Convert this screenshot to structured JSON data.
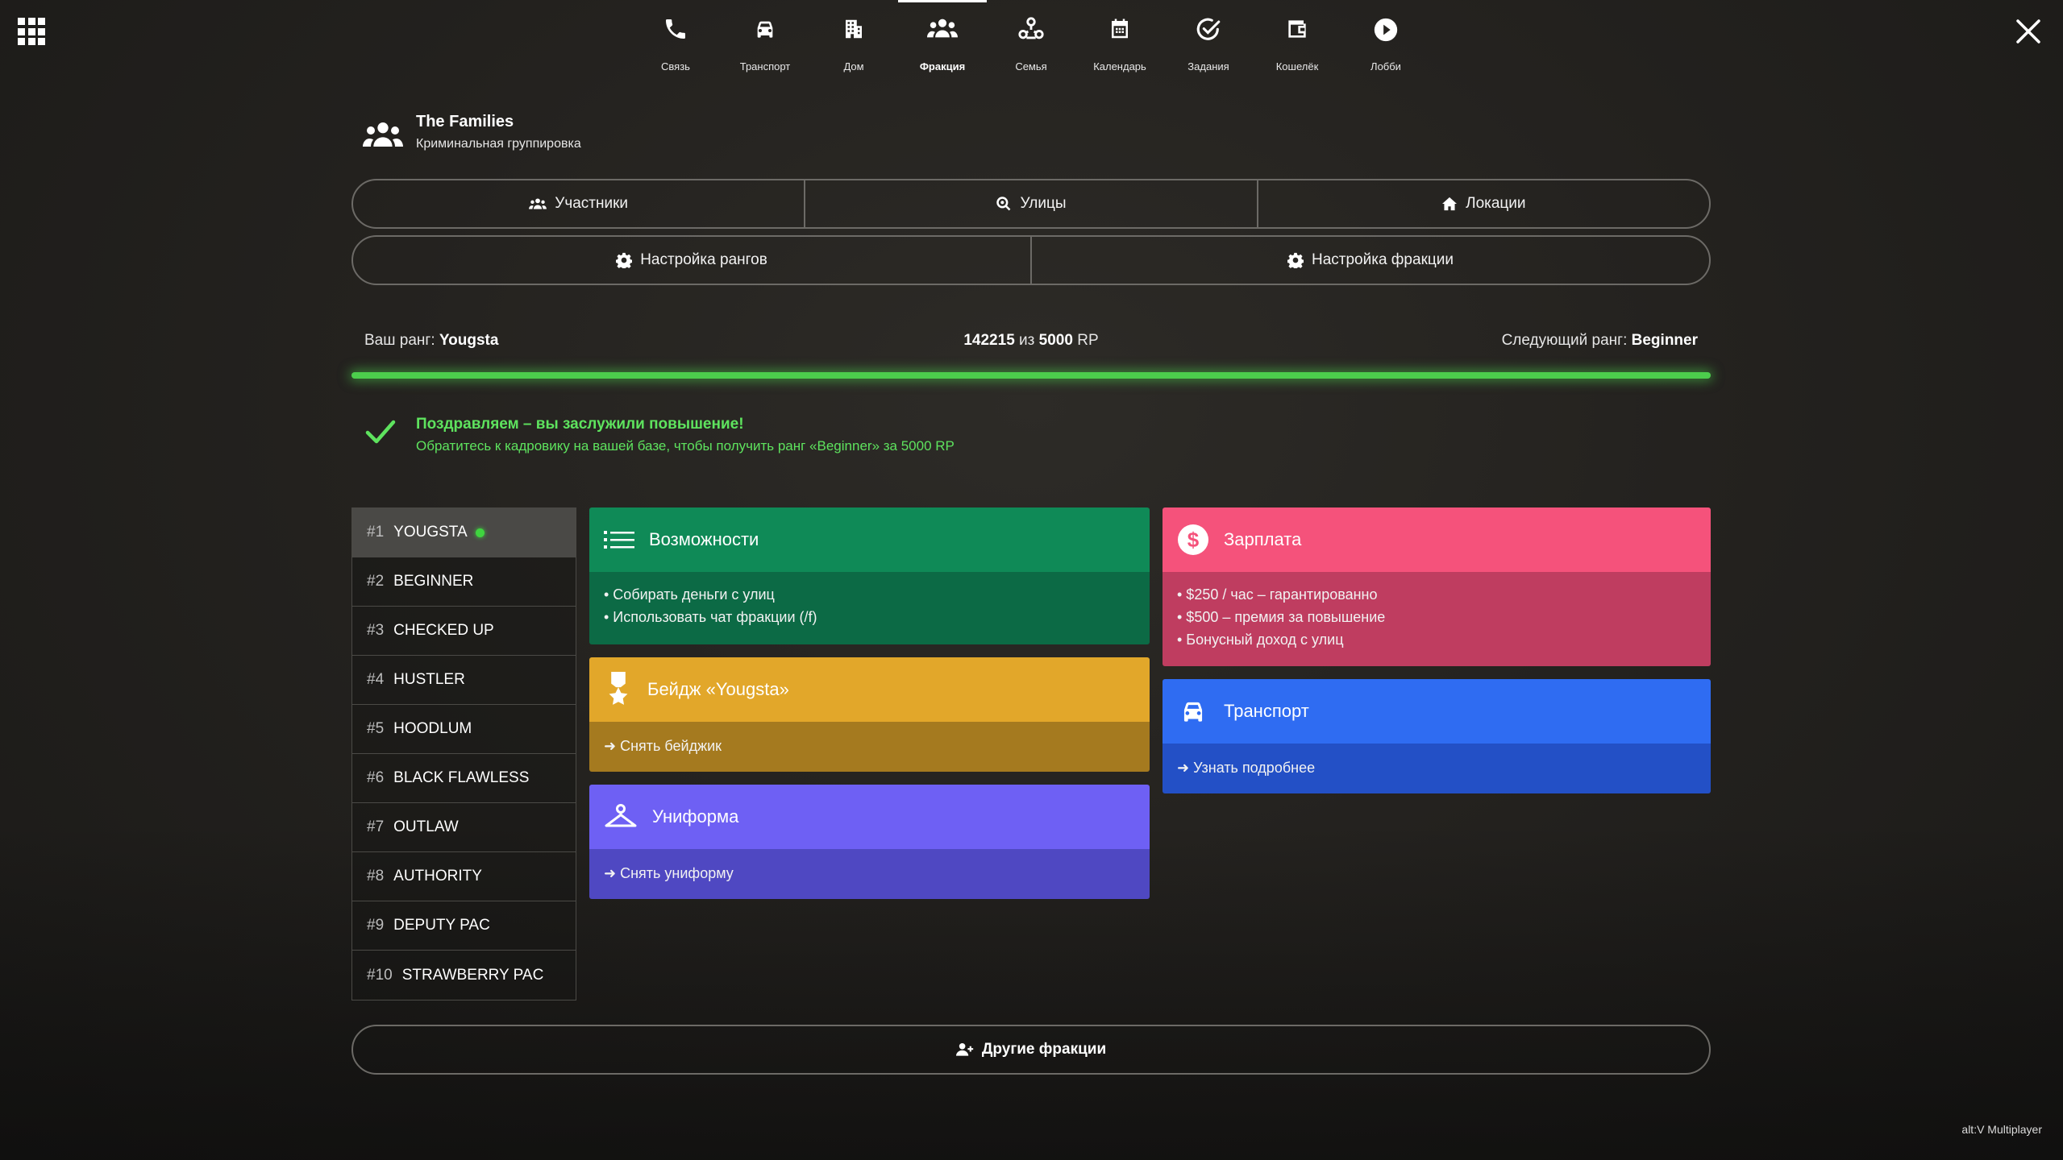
{
  "nav": {
    "items": [
      {
        "label": "Связь",
        "icon": "phone-icon"
      },
      {
        "label": "Транспорт",
        "icon": "car-icon"
      },
      {
        "label": "Дом",
        "icon": "building-icon"
      },
      {
        "label": "Фракция",
        "icon": "users-icon",
        "active": true
      },
      {
        "label": "Семья",
        "icon": "family-icon"
      },
      {
        "label": "Календарь",
        "icon": "calendar-icon"
      },
      {
        "label": "Задания",
        "icon": "check-circle-icon"
      },
      {
        "label": "Кошелёк",
        "icon": "wallet-icon"
      },
      {
        "label": "Лобби",
        "icon": "play-icon"
      }
    ]
  },
  "faction": {
    "name": "The Families",
    "subtitle": "Криминальная группировка"
  },
  "tabs_row1": [
    "Участники",
    "Улицы",
    "Локации"
  ],
  "tabs_row2": [
    "Настройка рангов",
    "Настройка фракции"
  ],
  "rank": {
    "your_label": "Ваш ранг:",
    "your_value": "Yougsta",
    "rp_current": "142215",
    "rp_of": "из",
    "rp_target": "5000",
    "rp_unit": "RP",
    "next_label": "Следующий ранг:",
    "next_value": "Beginner",
    "progress_fraction": 1.0,
    "progress_color": "#4ccd4c"
  },
  "congrats": {
    "title": "Поздравляем – вы заслужили повышение!",
    "text": "Обратитесь к кадровику на вашей базе, чтобы получить ранг «Beginner» за 5000 RP"
  },
  "ranks": [
    {
      "num": "#1",
      "name": "YOUGSTA",
      "active": true
    },
    {
      "num": "#2",
      "name": "BEGINNER"
    },
    {
      "num": "#3",
      "name": "CHECKED UP"
    },
    {
      "num": "#4",
      "name": "HUSTLER"
    },
    {
      "num": "#5",
      "name": "HOODLUM"
    },
    {
      "num": "#6",
      "name": "BLACK FLAWLESS"
    },
    {
      "num": "#7",
      "name": "OUTLAW"
    },
    {
      "num": "#8",
      "name": "AUTHORITY"
    },
    {
      "num": "#9",
      "name": "DEPUTY PAC"
    },
    {
      "num": "#10",
      "name": "STRAWBERRY PAC"
    }
  ],
  "cards": {
    "features": {
      "title": "Возможности",
      "lines": [
        "• Собирать деньги с улиц",
        "• Использовать чат фракции (/f)"
      ],
      "color": "#0f8a57"
    },
    "badge": {
      "title": "Бейдж «Yougsta»",
      "link": "➜ Снять бейджик",
      "color": "#e2a72a"
    },
    "uniform": {
      "title": "Униформа",
      "link": "➜ Снять униформу",
      "color": "#6e60f4"
    },
    "salary": {
      "title": "Зарплата",
      "lines": [
        "• $250 / час – гарантированно",
        "• $500 – премия за повышение",
        "• Бонусный доход с улиц"
      ],
      "color": "#f5527b"
    },
    "transport": {
      "title": "Транспорт",
      "link": "➜ Узнать подробнее",
      "color": "#2f6cf2"
    }
  },
  "other_factions": "Другие фракции",
  "brand": "alt:V Multiplayer"
}
